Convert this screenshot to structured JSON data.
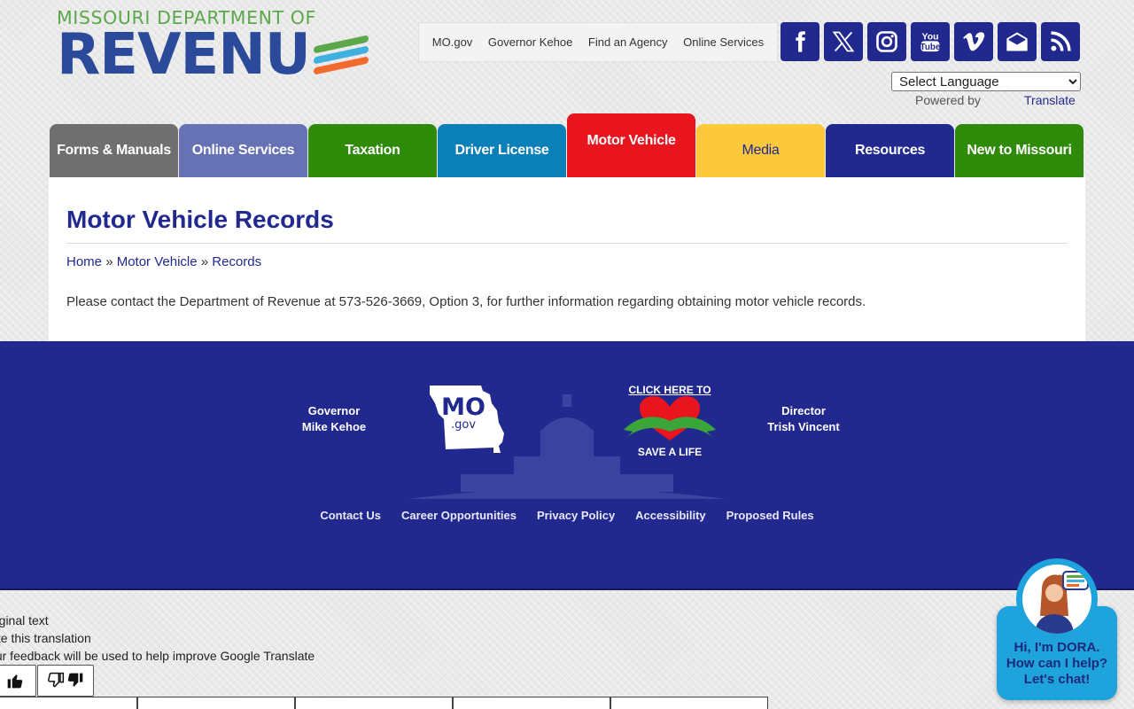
{
  "logo": {
    "tagline": "MISSOURI DEPARTMENT OF",
    "wordmark": "REVENU",
    "colors": {
      "green": "#5aa84a",
      "blue": "#2b4a9a",
      "light_blue": "#3fb0e0",
      "orange": "#f26a2e"
    }
  },
  "topnav": {
    "items": [
      "MO.gov",
      "Governor Kehoe",
      "Find an Agency",
      "Online Services"
    ]
  },
  "social": {
    "icons": [
      "facebook-icon",
      "x-icon",
      "instagram-icon",
      "youtube-icon",
      "vimeo-icon",
      "email-icon",
      "rss-icon"
    ],
    "color": "#21298f"
  },
  "language": {
    "selected": "Select Language",
    "powered_by": "Powered by",
    "translate_label": "Translate"
  },
  "mainnav": {
    "tabs": [
      {
        "label": "Forms & Manuals",
        "color": "#6f6f6f"
      },
      {
        "label": "Online Services",
        "color": "#6672b4"
      },
      {
        "label": "Taxation",
        "color": "#2f8a0a"
      },
      {
        "label": "Driver License",
        "color": "#0b7fb8"
      },
      {
        "label": "Motor Vehicle",
        "color": "#e8141e",
        "active": true
      },
      {
        "label": "Media",
        "color": "#fcc83c",
        "text_color": "#21298f"
      },
      {
        "label": "Resources",
        "color": "#21298f"
      },
      {
        "label": "New to Missouri",
        "color": "#2f8a0a"
      }
    ]
  },
  "page": {
    "title": "Motor Vehicle Records",
    "breadcrumb": [
      "Home",
      "Motor Vehicle",
      "Records"
    ],
    "breadcrumb_sep": "»",
    "body": "Please contact the Department of Revenue at 573-526-3669, Option 3, for further information regarding obtaining motor vehicle records."
  },
  "footer": {
    "governor": {
      "title": "Governor",
      "name": "Mike Kehoe"
    },
    "director": {
      "title": "Director",
      "name": "Trish Vincent"
    },
    "mogov": {
      "mo": "MO",
      "gov": ".gov"
    },
    "save": {
      "top": "CLICK HERE TO",
      "bottom": "SAVE A LIFE"
    },
    "links": [
      "Contact Us",
      "Career Opportunities",
      "Privacy Policy",
      "Accessibility",
      "Proposed Rules"
    ],
    "bg": "#21298f"
  },
  "translation_feedback": {
    "line1": "Original text",
    "line2": "Rate this translation",
    "line3": "Your feedback will be used to help improve Google Translate"
  },
  "chat": {
    "line1": "Hi, I'm DORA.",
    "line2": "How can I help?",
    "line3": "Let's chat!",
    "color": "#1fa3dc"
  }
}
